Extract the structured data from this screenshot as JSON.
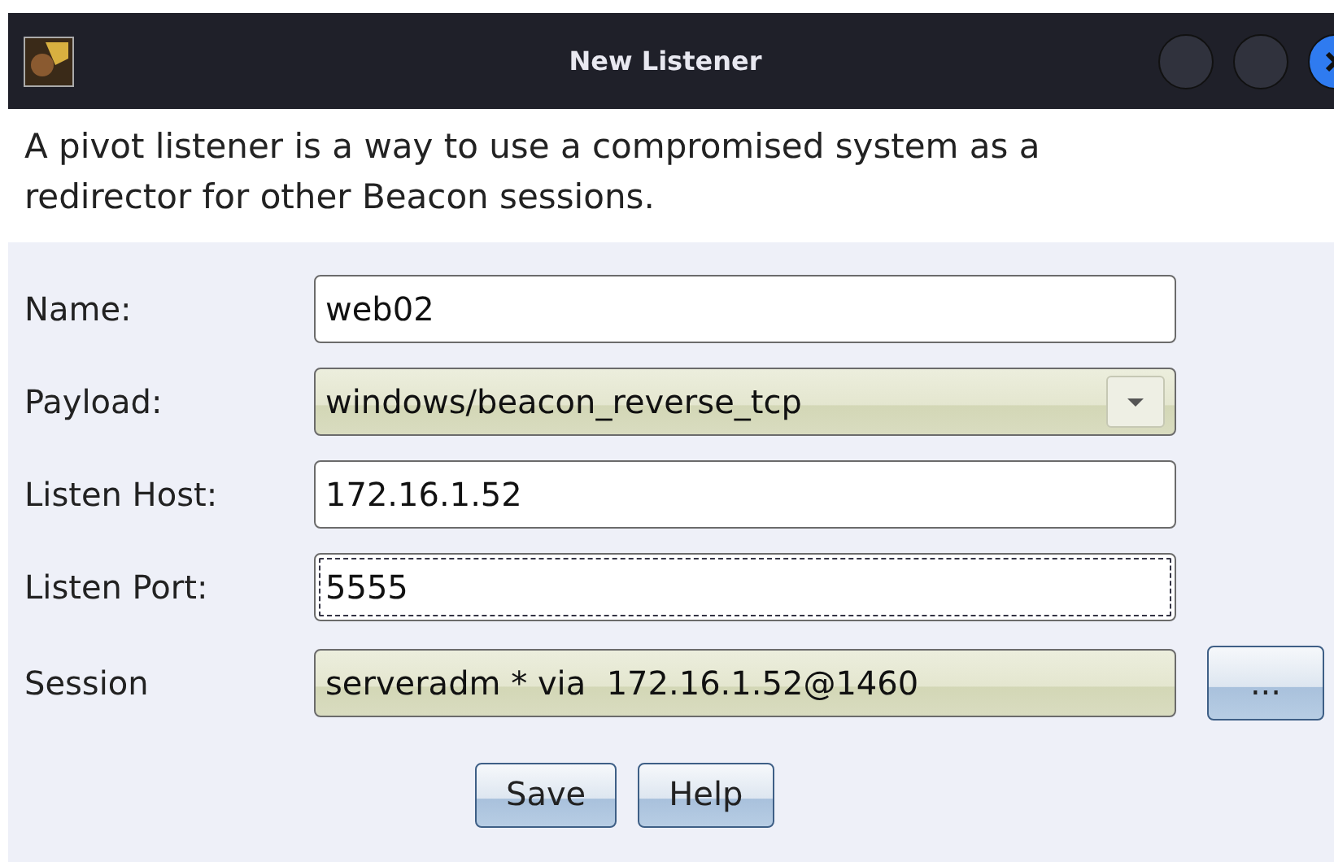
{
  "window": {
    "title": "New Listener"
  },
  "description": "A pivot listener is a way to use a compromised system as a redirector for other Beacon sessions.",
  "fields": [
    {
      "label": "Name:",
      "kind": "text",
      "value": "web02",
      "focused": false
    },
    {
      "label": "Payload:",
      "kind": "select",
      "value": "windows/beacon_reverse_tcp",
      "focused": false
    },
    {
      "label": "Listen Host:",
      "kind": "text",
      "value": "172.16.1.52",
      "focused": false
    },
    {
      "label": "Listen Port:",
      "kind": "text",
      "value": "5555",
      "focused": true
    },
    {
      "label": "Session",
      "kind": "readonly",
      "value": "serveradm * via  172.16.1.52@1460",
      "focused": false,
      "button": "..."
    }
  ],
  "buttons": [
    "Save",
    "Help"
  ]
}
